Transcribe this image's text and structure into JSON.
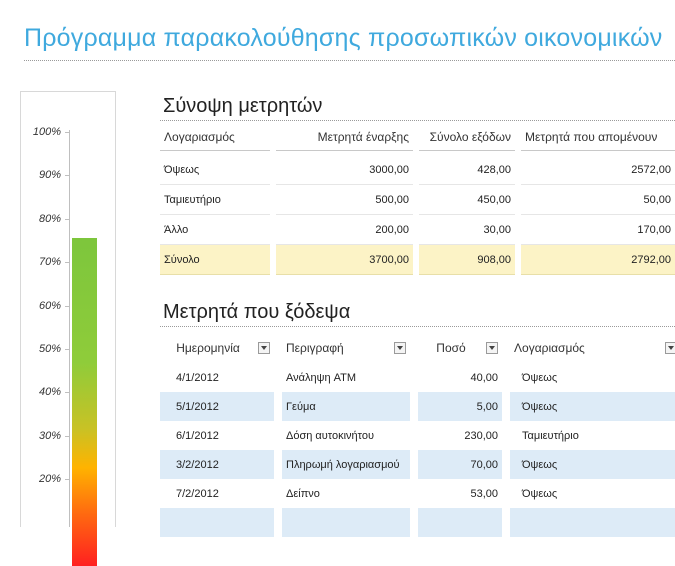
{
  "title": "Πρόγραμμα παρακολούθησης προσωπικών οικονομικών",
  "gauge": {
    "ticks": [
      "100%",
      "90%",
      "80%",
      "70%",
      "60%",
      "50%",
      "40%",
      "30%",
      "20%"
    ],
    "level_percent": 75.5
  },
  "summary": {
    "heading": "Σύνοψη μετρητών",
    "columns": [
      "Λογαριασμός",
      "Μετρητά έναρξης",
      "Σύνολο εξόδων",
      "Μετρητά που απομένουν"
    ],
    "rows": [
      [
        "Όψεως",
        "3000,00",
        "428,00",
        "2572,00"
      ],
      [
        "Ταμιευτήριο",
        "500,00",
        "450,00",
        "50,00"
      ],
      [
        "Άλλο",
        "200,00",
        "30,00",
        "170,00"
      ]
    ],
    "total": [
      "Σύνολο",
      "3700,00",
      "908,00",
      "2792,00"
    ]
  },
  "expenses": {
    "heading": "Μετρητά που ξόδεψα",
    "columns": [
      "Ημερομηνία",
      "Περιγραφή",
      "Ποσό",
      "Λογαριασμός"
    ],
    "rows": [
      [
        "4/1/2012",
        "Ανάληψη ATM",
        "40,00",
        "Όψεως"
      ],
      [
        "5/1/2012",
        "Γεύμα",
        "5,00",
        "Όψεως"
      ],
      [
        "6/1/2012",
        "Δόση αυτοκινήτου",
        "230,00",
        "Ταμιευτήριο"
      ],
      [
        "3/2/2012",
        "Πληρωμή λογαριασμού",
        "70,00",
        "Όψεως"
      ],
      [
        "7/2/2012",
        "Δείπνο",
        "53,00",
        "Όψεως"
      ]
    ]
  }
}
